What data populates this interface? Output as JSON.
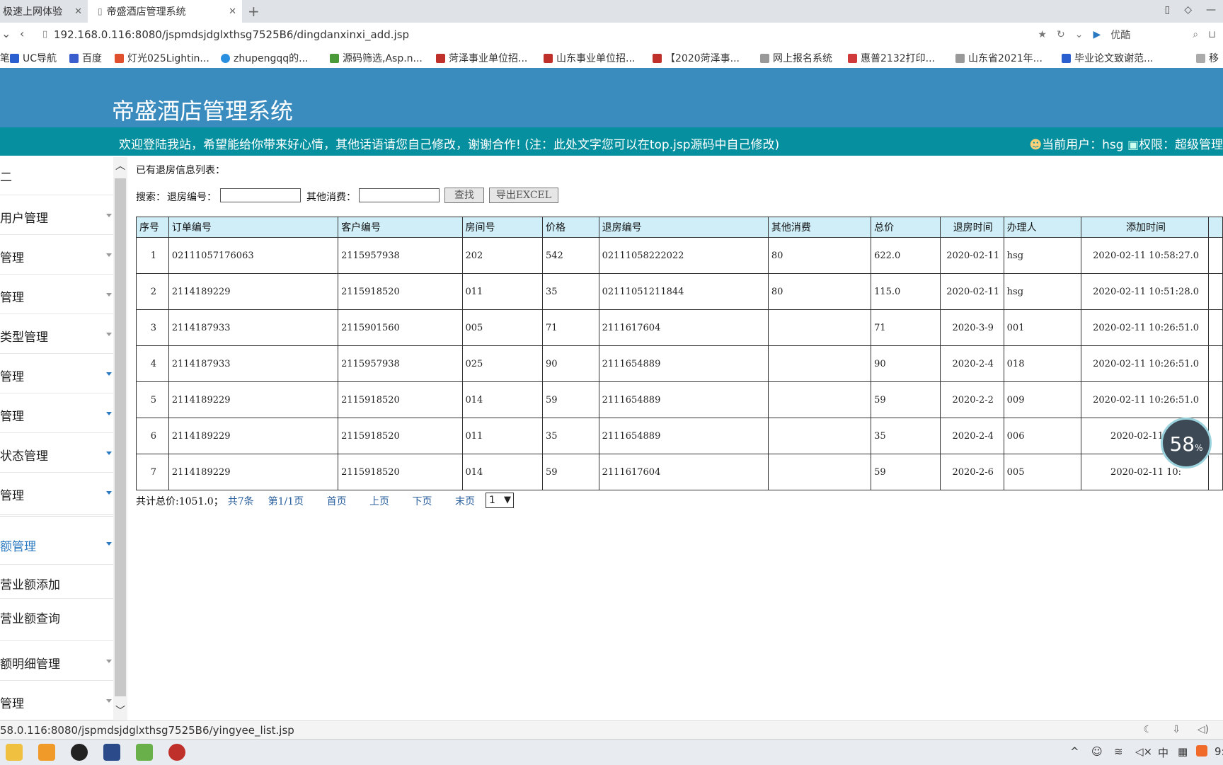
{
  "browser": {
    "tabs": [
      {
        "label": "极速上网体验"
      },
      {
        "label": "帝盛酒店管理系统"
      }
    ],
    "url": "192.168.0.116:8080/jspmdsjdglxthsg7525B6/dingdanxinxi_add.jsp",
    "search_engine": "优酷",
    "bookmarks": [
      "UC导航",
      "百度",
      "灯光025Lightin...",
      "zhupengqq的...",
      "源码筛选,Asp.n...",
      "菏泽事业单位招...",
      "山东事业单位招...",
      "【2020菏泽事...",
      "网上报名系统",
      "惠普2132打印...",
      "山东省2021年...",
      "毕业论文致谢范...",
      "移"
    ],
    "status_url": "58.0.116:8080/jspmdsjdglxthsg7525B6/yingyee_list.jsp"
  },
  "header": {
    "title": "帝盛酒店管理系统",
    "welcome": "欢迎登陆我站，希望能给你带来好心情，其他话语请您自己修改，谢谢合作!   (注：此处文字您可以在top.jsp源码中自己修改)",
    "current_user_label": "当前用户：hsg",
    "permission_label": "权限：超级管理"
  },
  "sidebar": {
    "items": [
      {
        "label": "用户管理"
      },
      {
        "label": "管理"
      },
      {
        "label": "管理"
      },
      {
        "label": "类型管理"
      },
      {
        "label": "管理"
      },
      {
        "label": "管理"
      },
      {
        "label": "状态管理"
      },
      {
        "label": "管理"
      },
      {
        "label": "额管理"
      },
      {
        "label": "营业额添加"
      },
      {
        "label": "营业额查询"
      },
      {
        "label": "额明细管理"
      },
      {
        "label": "管理"
      }
    ]
  },
  "content": {
    "list_title": "已有退房信息列表：",
    "search_label": "搜索：",
    "field1_label": "退房编号：",
    "field2_label": "其他消费：",
    "search_button": "查找",
    "export_button": "导出EXCEL",
    "table": {
      "headers": [
        "序号",
        "订单编号",
        "客户编号",
        "房间号",
        "价格",
        "退房编号",
        "其他消费",
        "总价",
        "退房时间",
        "办理人",
        "添加时间"
      ],
      "rows": [
        [
          "1",
          "02111057176063",
          "2115957938",
          "202",
          "542",
          "02111058222022",
          "80",
          "622.0",
          "2020-02-11",
          "hsg",
          "2020-02-11 10:58:27.0"
        ],
        [
          "2",
          "2114189229",
          "2115918520",
          "011",
          "35",
          "02111051211844",
          "80",
          "115.0",
          "2020-02-11",
          "hsg",
          "2020-02-11 10:51:28.0"
        ],
        [
          "3",
          "2114187933",
          "2115901560",
          "005",
          "71",
          "2111617604",
          "",
          "71",
          "2020-3-9",
          "001",
          "2020-02-11 10:26:51.0"
        ],
        [
          "4",
          "2114187933",
          "2115957938",
          "025",
          "90",
          "2111654889",
          "",
          "90",
          "2020-2-4",
          "018",
          "2020-02-11 10:26:51.0"
        ],
        [
          "5",
          "2114189229",
          "2115918520",
          "014",
          "59",
          "2111654889",
          "",
          "59",
          "2020-2-2",
          "009",
          "2020-02-11 10:26:51.0"
        ],
        [
          "6",
          "2114189229",
          "2115918520",
          "011",
          "35",
          "2111654889",
          "",
          "35",
          "2020-2-4",
          "006",
          "2020-02-11 10:"
        ],
        [
          "7",
          "2114189229",
          "2115918520",
          "014",
          "59",
          "2111617604",
          "",
          "59",
          "2020-2-6",
          "005",
          "2020-02-11 10:"
        ]
      ]
    },
    "pager": {
      "total_price": "共计总价:1051.0；",
      "count": "共7条",
      "page_info": "第1/1页",
      "first": "首页",
      "prev": "上页",
      "next": "下页",
      "last": "末页",
      "selected_page": "1"
    }
  },
  "overlay_badge": {
    "value": "58",
    "unit": "%"
  },
  "taskbar": {
    "clock": "9:"
  }
}
